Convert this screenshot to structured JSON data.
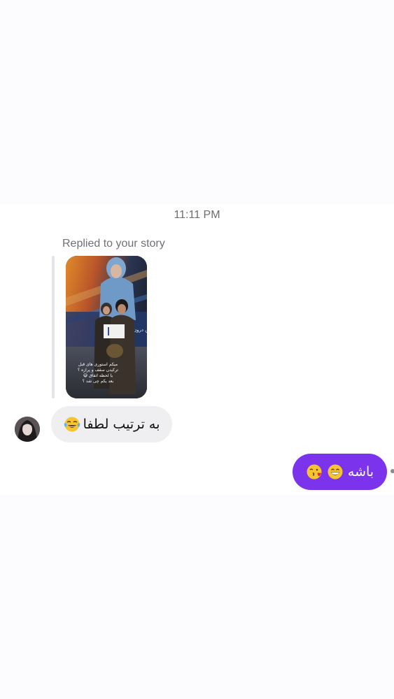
{
  "thread": {
    "timestamp": "11:11 PM",
    "story_reply": {
      "label": "Replied to your story",
      "overlay_lines": [
        "میکم استوری های قبل",
        "ترکیدن سقف و پرازه ؟",
        "یا لحظه اتفاق 😅",
        "بعد یکم چی شد ؟"
      ]
    },
    "incoming": {
      "text": "به ترتیب لطفا",
      "emoji": "face-with-tears-of-joy-icon"
    },
    "outgoing": {
      "text": "باشه",
      "emojis": [
        "grinning-face-icon",
        "face-blowing-kiss-icon"
      ]
    }
  },
  "colors": {
    "outgoing_bubble": "#7b33ec",
    "incoming_bubble": "#efeff1",
    "timestamp_text": "#6d6e72"
  }
}
